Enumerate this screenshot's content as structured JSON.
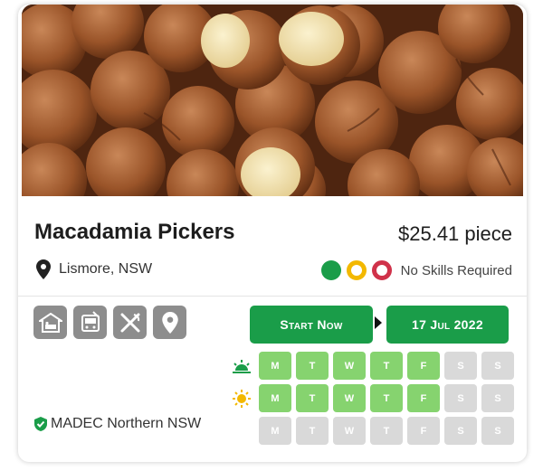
{
  "job": {
    "title": "Macadamia Pickers",
    "price": "$25.41 piece",
    "location": "Lismore, NSW",
    "skills": "No Skills Required",
    "organization": "MADEC Northern NSW"
  },
  "actions": {
    "start_label": "Start Now",
    "date_label": "17 Jul 2022"
  },
  "amenities": [
    "accommodation-icon",
    "transport-icon",
    "meals-icon",
    "location-pin-icon"
  ],
  "schedule": {
    "days": [
      "M",
      "T",
      "W",
      "T",
      "F",
      "S",
      "S"
    ],
    "morning": [
      true,
      true,
      true,
      true,
      true,
      false,
      false
    ],
    "day": [
      true,
      true,
      true,
      true,
      true,
      false,
      false
    ],
    "night": [
      false,
      false,
      false,
      false,
      false,
      false,
      false
    ]
  },
  "colors": {
    "accent": "#1a9d49",
    "active_day": "#86d36f",
    "inactive_day": "#d9d9d9",
    "yellow": "#f3b800",
    "red": "#d0324a"
  }
}
